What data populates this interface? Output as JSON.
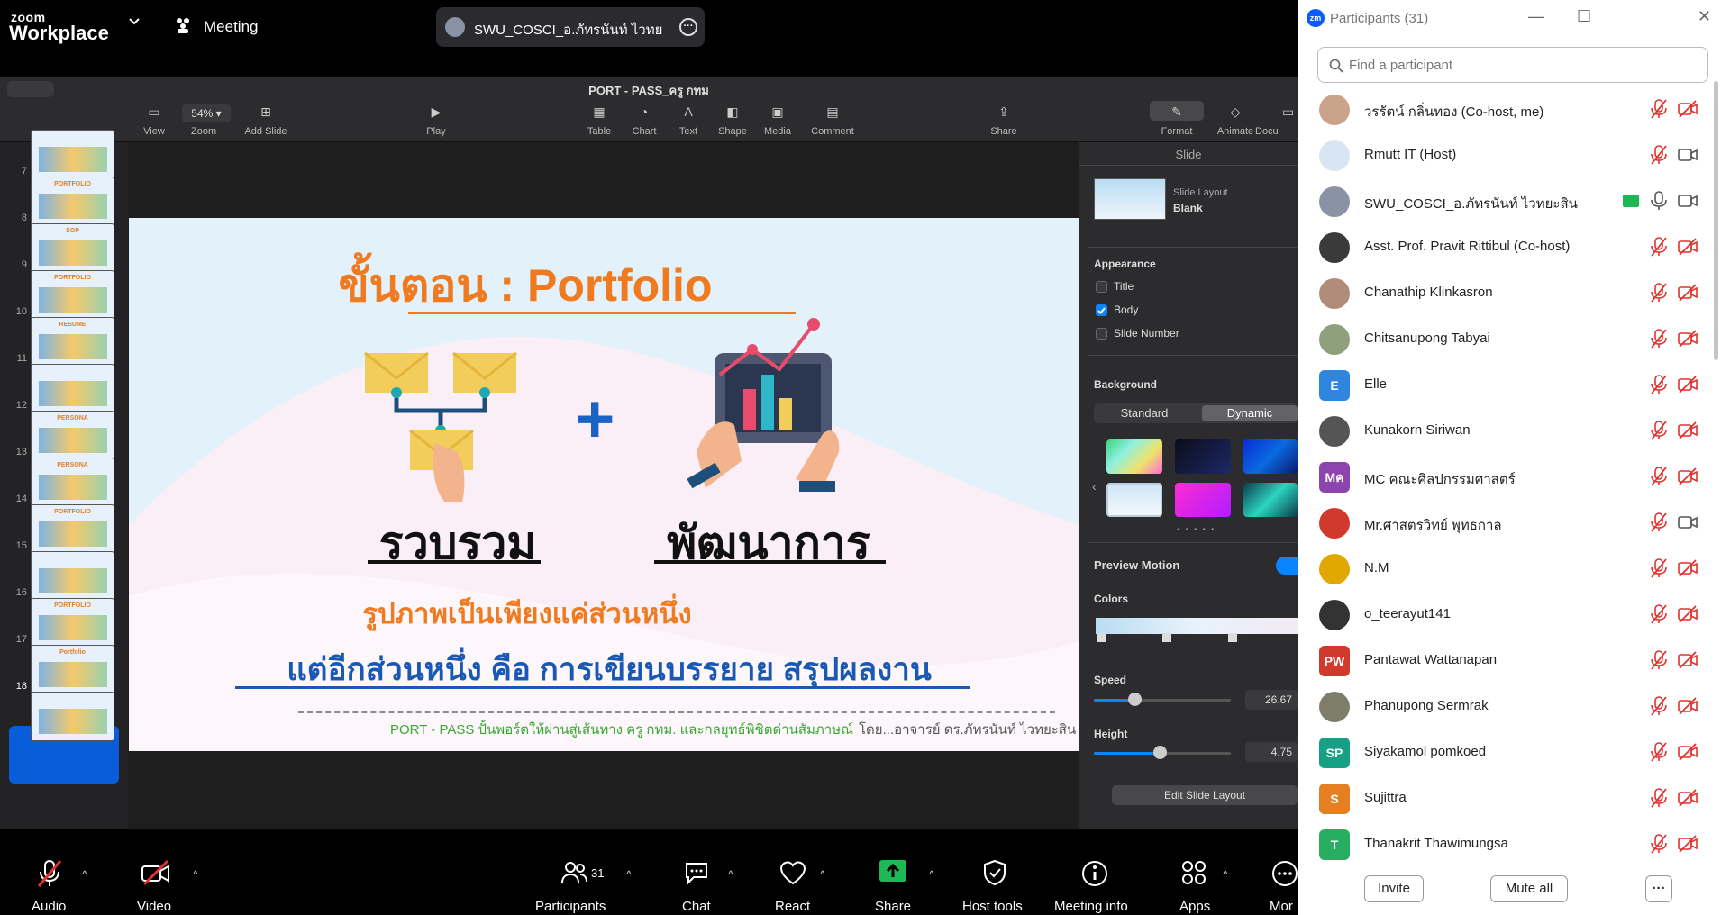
{
  "zoom": {
    "logo_top": "zoom",
    "logo_bottom": "Workplace",
    "meeting_label": "Meeting",
    "share_pill_text": "SWU_COSCI_อ.ภัทรนันท์ ไวทยะสิน's s"
  },
  "keynote": {
    "document_title": "PORT - PASS_ครู กทม",
    "zoom_value": "54%",
    "toolbar": {
      "view": "View",
      "zoom": "Zoom",
      "add_slide": "Add Slide",
      "play": "Play",
      "table": "Table",
      "chart": "Chart",
      "text": "Text",
      "shape": "Shape",
      "media": "Media",
      "comment": "Comment",
      "share": "Share",
      "format": "Format",
      "animate": "Animate",
      "document": "Docu"
    },
    "slide_numbers": [
      "7",
      "8",
      "9",
      "10",
      "11",
      "12",
      "13",
      "14",
      "15",
      "16",
      "17",
      "18"
    ],
    "thumb_labels": [
      "",
      "PORTFOLIO",
      "SOP",
      "PORTFOLIO",
      "RESUME",
      "",
      "PERSONA",
      "PERSONA",
      "PORTFOLIO",
      "",
      "PORTFOLIO",
      "Portfolio",
      ""
    ],
    "active_slide": "18",
    "slide": {
      "title": "ขั้นตอน : Portfolio",
      "plus": "+",
      "word_left": "รวบรวม",
      "word_right": "พัฒนาการ",
      "subtitle1": "รูปภาพเป็นเพียงแค่ส่วนหนึ่ง",
      "subtitle2": "แต่อีกส่วนหนึ่ง คือ การเขียนบรรยาย สรุปผลงาน",
      "footer_left": "PORT - PASS ปั้นพอร์ตให้ผ่านสู่เส้นทาง ครู กทม. และกลยุทธ์พิชิตด่านสัมภาษณ์",
      "footer_right": "โดย...อาจารย์ ดร.ภัทรนันท์ ไวทยะสิน"
    },
    "inspector": {
      "header": "Slide",
      "layout_label": "Slide Layout",
      "layout_value": "Blank",
      "appearance": "Appearance",
      "title_opt": "Title",
      "body_opt": "Body",
      "slide_number_opt": "Slide Number",
      "background": "Background",
      "standard": "Standard",
      "dynamic": "Dynamic",
      "preview_motion": "Preview Motion",
      "colors": "Colors",
      "speed": "Speed",
      "speed_value": "26.67",
      "height": "Height",
      "height_value": "4.75",
      "edit_layout": "Edit Slide Layout"
    }
  },
  "bottombar": {
    "audio": "Audio",
    "video": "Video",
    "participants": "Participants",
    "participants_count": "31",
    "chat": "Chat",
    "react": "React",
    "share": "Share",
    "host_tools": "Host tools",
    "meeting_info": "Meeting info",
    "apps": "Apps",
    "more": "Mor"
  },
  "participants_panel": {
    "title": "Participants (31)",
    "search_placeholder": "Find a participant",
    "invite": "Invite",
    "mute_all": "Mute all",
    "more": "···",
    "people": [
      {
        "name": "วรรัตน์ กลิ่นทอง (Co-host, me)",
        "initials": "",
        "avatar_color": "#c9a48a",
        "muted": true,
        "video_off": true
      },
      {
        "name": "Rmutt IT (Host)",
        "initials": "",
        "avatar_color": "#d7e6f2",
        "muted": true,
        "video_off": false
      },
      {
        "name": "SWU_COSCI_อ.ภัทรนันท์ ไวทยะสิน",
        "initials": "",
        "avatar_color": "#8a93a6",
        "muted": false,
        "video_off": false
      },
      {
        "name": "Asst. Prof. Pravit Rittibul (Co-host)",
        "initials": "",
        "avatar_color": "#3a3a3a",
        "muted": true,
        "video_off": true
      },
      {
        "name": "Chanathip Klinkasron",
        "initials": "",
        "avatar_color": "#b08c7a",
        "muted": true,
        "video_off": true
      },
      {
        "name": "Chitsanupong Tabyai",
        "initials": "",
        "avatar_color": "#8ea07c",
        "muted": true,
        "video_off": true
      },
      {
        "name": "Elle",
        "initials": "E",
        "avatar_color": "#2e86de",
        "muted": true,
        "video_off": true
      },
      {
        "name": "Kunakorn Siriwan",
        "initials": "",
        "avatar_color": "#555555",
        "muted": true,
        "video_off": true
      },
      {
        "name": "MC คณะศิลปกรรมศาสตร์",
        "initials": "Mค",
        "avatar_color": "#8e44ad",
        "muted": true,
        "video_off": true
      },
      {
        "name": "Mr.ศาสตรวิทย์ พุทธกาล",
        "initials": "",
        "avatar_color": "#d0392b",
        "muted": true,
        "video_off": false
      },
      {
        "name": "N.M",
        "initials": "",
        "avatar_color": "#e0a800",
        "muted": true,
        "video_off": true
      },
      {
        "name": "o_teerayut141",
        "initials": "",
        "avatar_color": "#333333",
        "muted": true,
        "video_off": true
      },
      {
        "name": "Pantawat Wattanapan",
        "initials": "PW",
        "avatar_color": "#d0392b",
        "muted": true,
        "video_off": true
      },
      {
        "name": "Phanupong Sermrak",
        "initials": "",
        "avatar_color": "#7d7d6a",
        "muted": true,
        "video_off": true
      },
      {
        "name": "Siyakamol pomkoed",
        "initials": "SP",
        "avatar_color": "#16a085",
        "muted": true,
        "video_off": true
      },
      {
        "name": "Sujittra",
        "initials": "S",
        "avatar_color": "#e67e22",
        "muted": true,
        "video_off": true
      },
      {
        "name": "Thanakrit Thawimungsa",
        "initials": "T",
        "avatar_color": "#27ae60",
        "muted": true,
        "video_off": true
      }
    ]
  }
}
